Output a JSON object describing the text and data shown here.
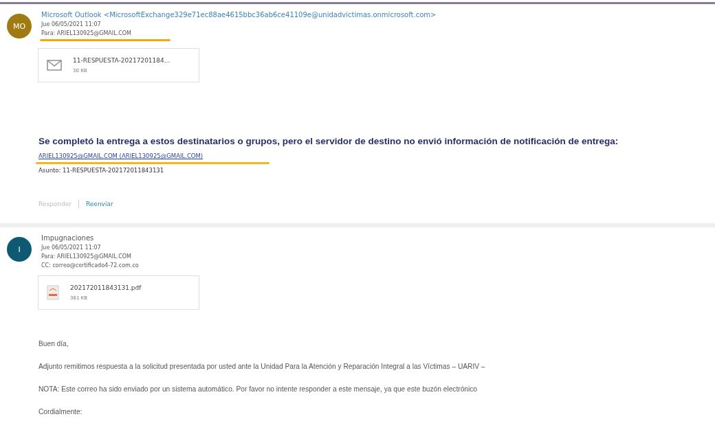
{
  "messages": [
    {
      "avatar": {
        "initials": "MO",
        "color": "#a07a12"
      },
      "sender": "Microsoft Outlook <MicrosoftExchange329e71ec88ae4615bbc36ab6ce41109e@unidadvictimas.onmicrosoft.com>",
      "date": "Jue 06/05/2021 11:07",
      "to": "Para: ARIEL130925@GMAIL.COM",
      "attachment": {
        "kind": "mail",
        "name": "11-RESPUESTA-20217201184...",
        "size": "30 KB"
      },
      "kind": "report",
      "heading": "Se completó la entrega a estos destinatarios o grupos, pero el servidor de destino no envió información de notificación de entrega:",
      "recipient_link": "ARIEL130925@GMAIL.COM (ARIEL130925@GMAIL.COM)",
      "subject": "Asunto: 11-RESPUESTA-202172011843131",
      "actions": [
        {
          "label": "Responder",
          "disabled": true
        },
        {
          "label": "Reenviar",
          "disabled": false
        }
      ]
    },
    {
      "avatar": {
        "initials": "I",
        "color": "#0f5a73"
      },
      "sender": "Impugnaciones",
      "date": "Jue 06/05/2021 11:07",
      "to": "Para: ARIEL130925@GMAIL.COM",
      "cc": "CC: correo@certificado4-72.com.co",
      "attachment": {
        "kind": "pdf",
        "name": "202172011843131.pdf",
        "size": "361 KB"
      },
      "kind": "body",
      "paragraphs": [
        "Buen día,",
        "Adjunto remitimos respuesta a la solicitud presentada por usted ante la Unidad Para la Atención y Reparación Integral a las Víctimas – UARIV –",
        "NOTA: Este correo ha sido enviado por un sistema automático. Por favor no intente responder a este mensaje, ya que este buzón electrónico",
        "Cordialmente:"
      ]
    }
  ]
}
